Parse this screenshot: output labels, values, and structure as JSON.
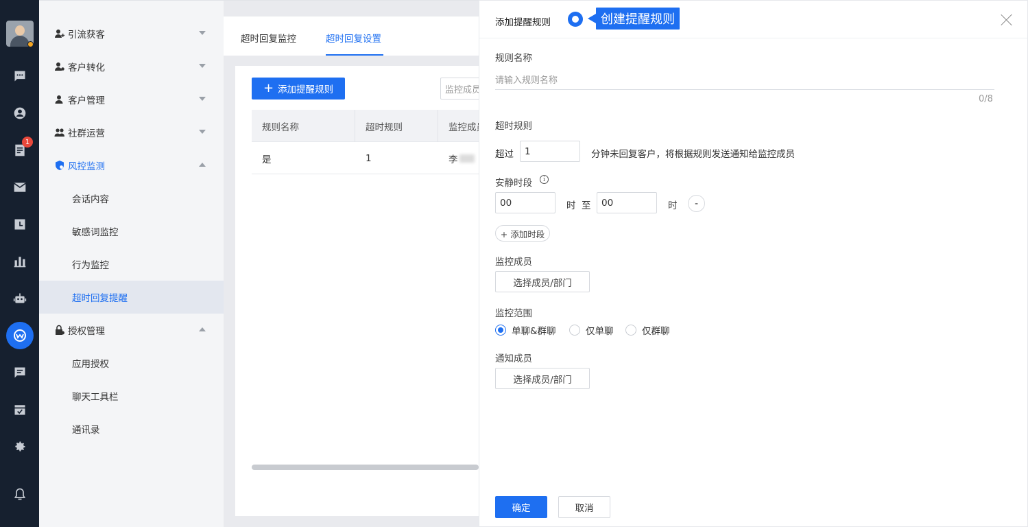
{
  "rail": {
    "badge_count": "1",
    "icons": [
      "chat-bubble-icon",
      "contact-icon",
      "document-icon",
      "mail-icon",
      "clock-icon",
      "bar-chart-icon",
      "robot-icon",
      "weibo-icon",
      "message-icon",
      "calendar-icon",
      "gear-icon",
      "bell-icon"
    ]
  },
  "sidebar": {
    "groups": [
      {
        "label": "引流获客"
      },
      {
        "label": "客户转化"
      },
      {
        "label": "客户管理"
      },
      {
        "label": "社群运营"
      },
      {
        "label": "风控监测"
      },
      {
        "label": "授权管理"
      }
    ],
    "risk_items": [
      "会话内容",
      "敏感词监控",
      "行为监控",
      "超时回复提醒"
    ],
    "auth_items": [
      "应用授权",
      "聊天工具栏",
      "通讯录"
    ]
  },
  "main": {
    "tabs": [
      "超时回复监控",
      "超时回复设置"
    ],
    "add_button": "添加提醒规则",
    "filter_placeholder": "监控成员",
    "columns": [
      "规则名称",
      "超时规则",
      "监控成员"
    ],
    "rows": [
      {
        "name": "是",
        "rule": "1",
        "member": "李"
      }
    ]
  },
  "drawer": {
    "title": "添加提醒规则",
    "callout": "创建提醒规则",
    "rule_name_label": "规则名称",
    "rule_name_placeholder": "请输入规则名称",
    "rule_name_counter": "0/8",
    "timeout_label": "超时规则",
    "timeout_prefix": "超过",
    "timeout_value": "1",
    "timeout_suffix": "分钟未回复客户，将根据规则发送通知给监控成员",
    "quiet_label": "安静时段",
    "quiet_start": "00",
    "quiet_hour_unit": "时",
    "quiet_to": "至",
    "quiet_end": "00",
    "quiet_end_unit": "时",
    "remove_label": "-",
    "add_period": "+ 添加时段",
    "monitor_members_label": "监控成员",
    "select_members": "选择成员/部门",
    "scope_label": "监控范围",
    "scope_options": [
      "单聊&群聊",
      "仅单聊",
      "仅群聊"
    ],
    "scope_selected": 0,
    "notify_label": "通知成员",
    "notify_select": "选择成员/部门",
    "confirm": "确定",
    "cancel": "取消"
  }
}
